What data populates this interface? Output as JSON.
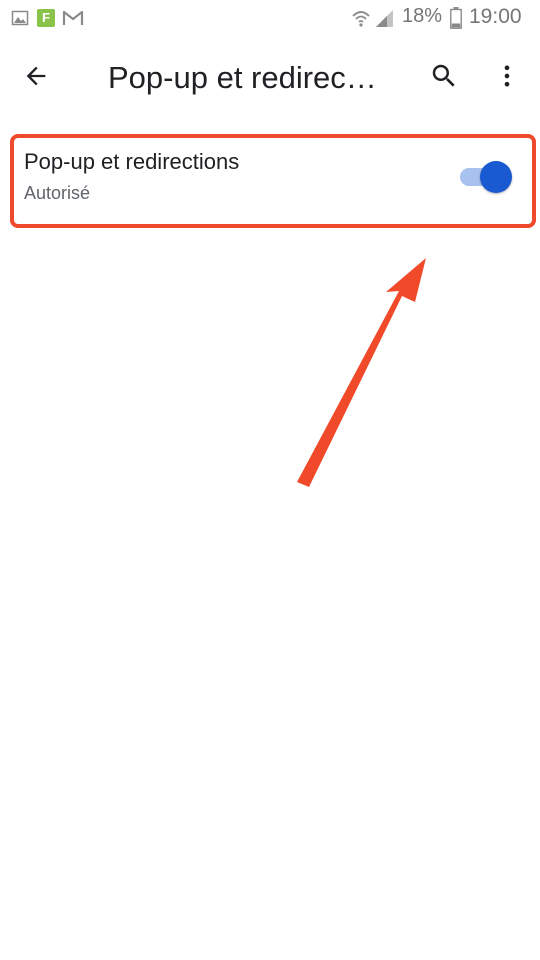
{
  "status_bar": {
    "icons": [
      "gallery-icon",
      "app-icon",
      "gmail-icon",
      "wifi-icon",
      "signal-icon",
      "battery-icon"
    ],
    "app_badge_letter": "F",
    "battery_percent": "18%",
    "time": "19:00"
  },
  "toolbar": {
    "title": "Pop-up et redirec…",
    "icons": [
      "back-arrow-icon",
      "search-icon",
      "more-vert-icon"
    ]
  },
  "setting": {
    "title": "Pop-up et redirections",
    "summary": "Autorisé",
    "toggle_on": true
  },
  "colors": {
    "toggle_thumb": "#1a5ad1",
    "toggle_track": "#a8c2ef",
    "annotation": "#ef4a2c",
    "text_primary": "#202124",
    "text_secondary": "#5f6368"
  }
}
